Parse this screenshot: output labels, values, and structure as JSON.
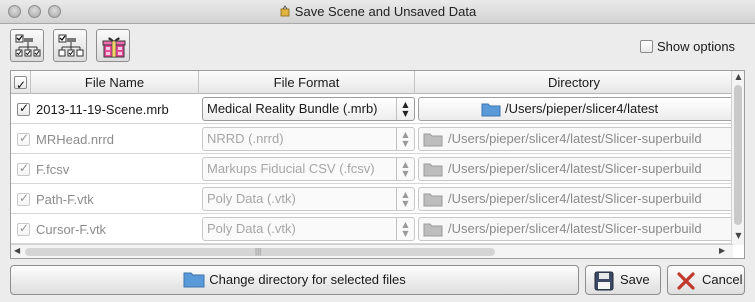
{
  "window": {
    "title": "Save Scene and Unsaved Data"
  },
  "toolbar": {
    "buttons": [
      "select-all-icon",
      "select-modified-icon",
      "package-icon"
    ],
    "show_options_label": "Show options",
    "show_options_checked": false
  },
  "table": {
    "headers": {
      "file_name": "File Name",
      "file_format": "File Format",
      "directory": "Directory"
    },
    "rows": [
      {
        "checked": true,
        "enabled": true,
        "name": "2013-11-19-Scene.mrb",
        "format": "Medical Reality Bundle (.mrb)",
        "directory": "/Users/pieper/slicer4/latest"
      },
      {
        "checked": true,
        "enabled": false,
        "name": "MRHead.nrrd",
        "format": "NRRD (.nrrd)",
        "directory": "/Users/pieper/slicer4/latest/Slicer-superbuild"
      },
      {
        "checked": true,
        "enabled": false,
        "name": "F.fcsv",
        "format": "Markups Fiducial CSV (.fcsv)",
        "directory": "/Users/pieper/slicer4/latest/Slicer-superbuild"
      },
      {
        "checked": true,
        "enabled": false,
        "name": "Path-F.vtk",
        "format": "Poly Data (.vtk)",
        "directory": "/Users/pieper/slicer4/latest/Slicer-superbuild"
      },
      {
        "checked": true,
        "enabled": false,
        "name": "Cursor-F.vtk",
        "format": "Poly Data (.vtk)",
        "directory": "/Users/pieper/slicer4/latest/Slicer-superbuild"
      }
    ]
  },
  "footer": {
    "change_dir_label": "Change directory for selected files",
    "save_label": "Save",
    "cancel_label": "Cancel"
  },
  "colors": {
    "folder": "#5b9ad9",
    "folder_dim": "#bdbdbd",
    "cancel_x": "#c0392b"
  }
}
